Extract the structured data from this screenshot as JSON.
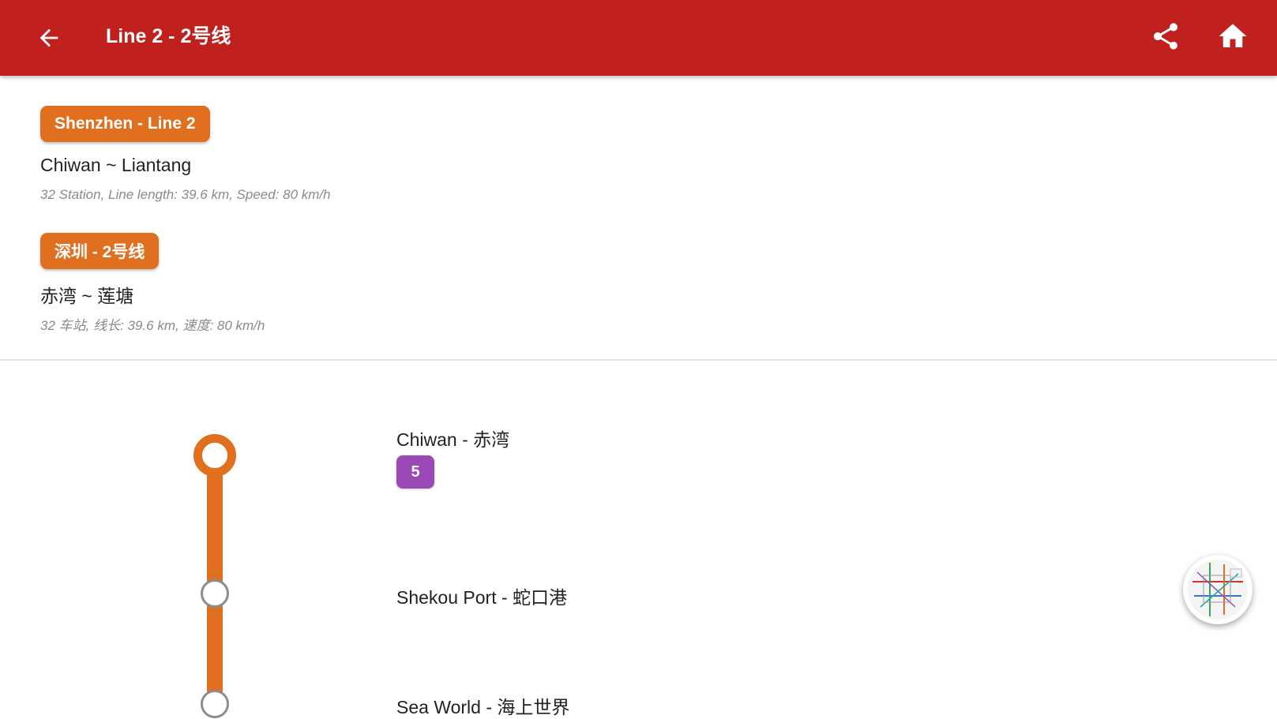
{
  "appbar": {
    "title": "Line 2 - 2号线",
    "back_icon": "arrow-back-icon",
    "share_icon": "share-icon",
    "home_icon": "home-icon"
  },
  "line_info": {
    "en": {
      "badge": "Shenzhen - Line 2",
      "route": "Chiwan ~ Liantang",
      "meta": "32 Station, Line length: 39.6 km, Speed: 80 km/h"
    },
    "zh": {
      "badge": "深圳 - 2号线",
      "route": "赤湾 ~ 莲塘",
      "meta": "32 车站, 线长: 39.6 km, 速度: 80 km/h"
    }
  },
  "stations": [
    {
      "name": "Chiwan - 赤湾",
      "transfers": [
        "5"
      ]
    },
    {
      "name": "Shekou Port - 蛇口港",
      "transfers": []
    },
    {
      "name": "Sea World - 海上世界",
      "transfers": []
    }
  ],
  "colors": {
    "appbar": "#c0201e",
    "line": "#e07020",
    "transfer_line_5": "#9a49b7",
    "stop_outline": "#8d8d8d"
  },
  "fab": {
    "icon": "metro-map-icon"
  }
}
